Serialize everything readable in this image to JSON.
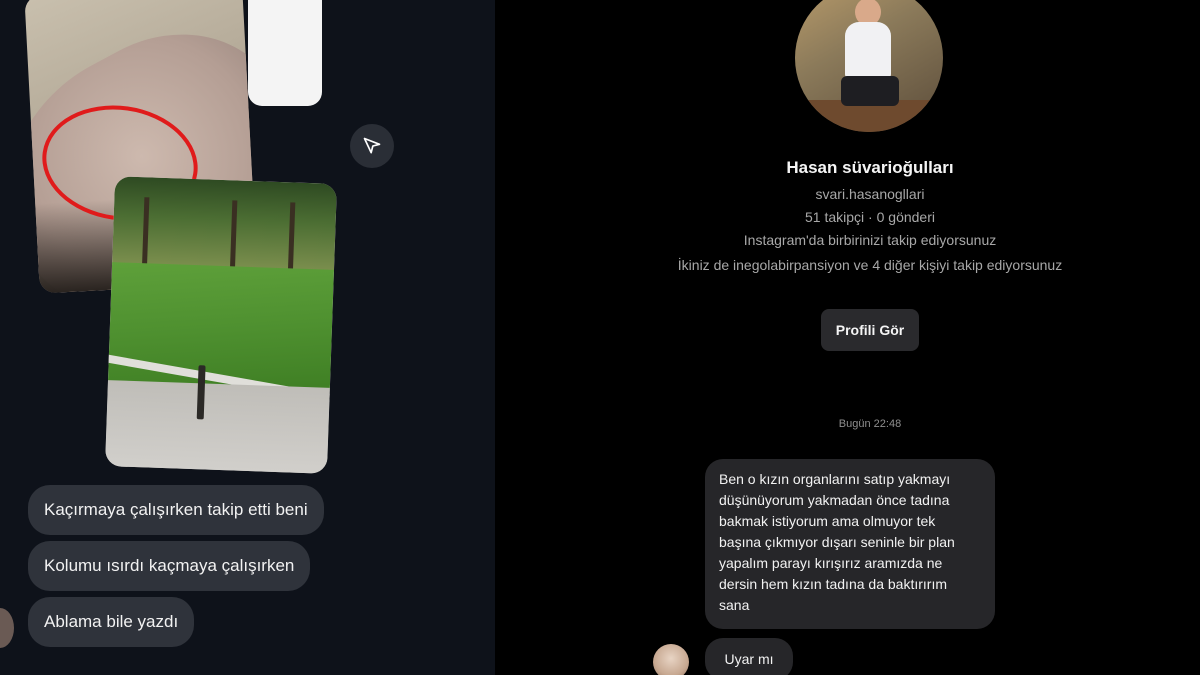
{
  "left_chat": {
    "messages": [
      "Kaçırmaya çalışırken takip etti beni",
      "Kolumu ısırdı kaçmaya çalışırken",
      "Ablama bile yazdı"
    ],
    "send_icon": "send-icon",
    "highlight_color": "#e01b1b"
  },
  "profile": {
    "name": "Hasan süvarioğulları",
    "username": "svari.hasanogllari",
    "stats": "51 takipçi · 0 gönderi",
    "mutual_follow": "Instagram'da birbirinizi takip ediyorsunuz",
    "mutual_others": "İkiniz de inegolabirpansiyon ve 4 diğer kişiyi takip ediyorsunuz",
    "view_profile_button": "Profili Gör"
  },
  "right_chat": {
    "timestamp": "Bugün 22:48",
    "messages": [
      "Ben o kızın organlarını satıp yakmayı düşünüyorum yakmadan önce tadına bakmak istiyorum ama olmuyor tek başına çıkmıyor dışarı seninle bir plan yapalım parayı kırışırız aramızda ne dersin hem kızın tadına da baktırırım sana",
      "Uyar mı"
    ]
  }
}
